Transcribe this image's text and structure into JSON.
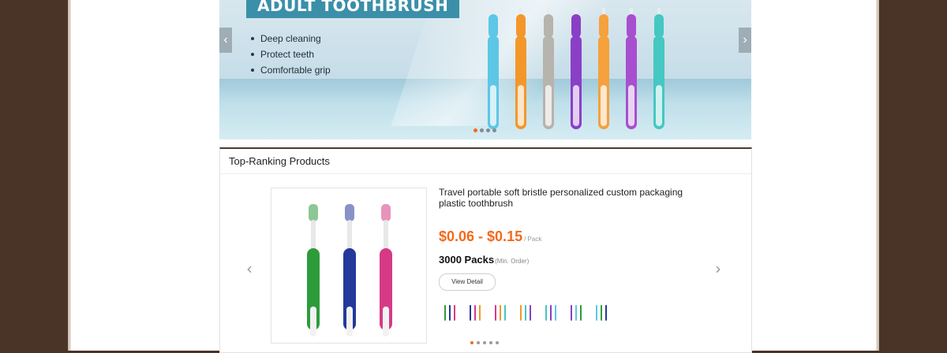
{
  "banner": {
    "title": "ADULT TOOTHBRUSH",
    "bullets": [
      "Deep cleaning",
      "Protect teeth",
      "Comfortable grip"
    ],
    "prev_icon": "‹",
    "next_icon": "›",
    "slide_count": 4,
    "active_slide": 0,
    "brush_colors": [
      "#5ec6e6",
      "#f4972b",
      "#b7b3ad",
      "#8a3fc6",
      "#f5a13c",
      "#a84fcf",
      "#45c7c2"
    ]
  },
  "ranking": {
    "title": "Top-Ranking Products",
    "prev_icon": "‹",
    "next_icon": "›",
    "product": {
      "title": "Travel portable soft bristle personalized custom packaging plastic toothbrush",
      "price": "$0.06 - $0.15",
      "price_unit": "/ Pack",
      "moq": "3000 Packs",
      "moq_note": "(Min. Order)",
      "view_detail": "View Detail",
      "image_colors": [
        "#2e9b3b",
        "#23399b",
        "#d63a86"
      ]
    },
    "thumbnail_count": 7,
    "slide_count": 5,
    "active_slide": 0
  },
  "colors": {
    "accent": "#f26a1b",
    "background": "#4a3327",
    "banner_title_bg": "#3b8fa9"
  }
}
